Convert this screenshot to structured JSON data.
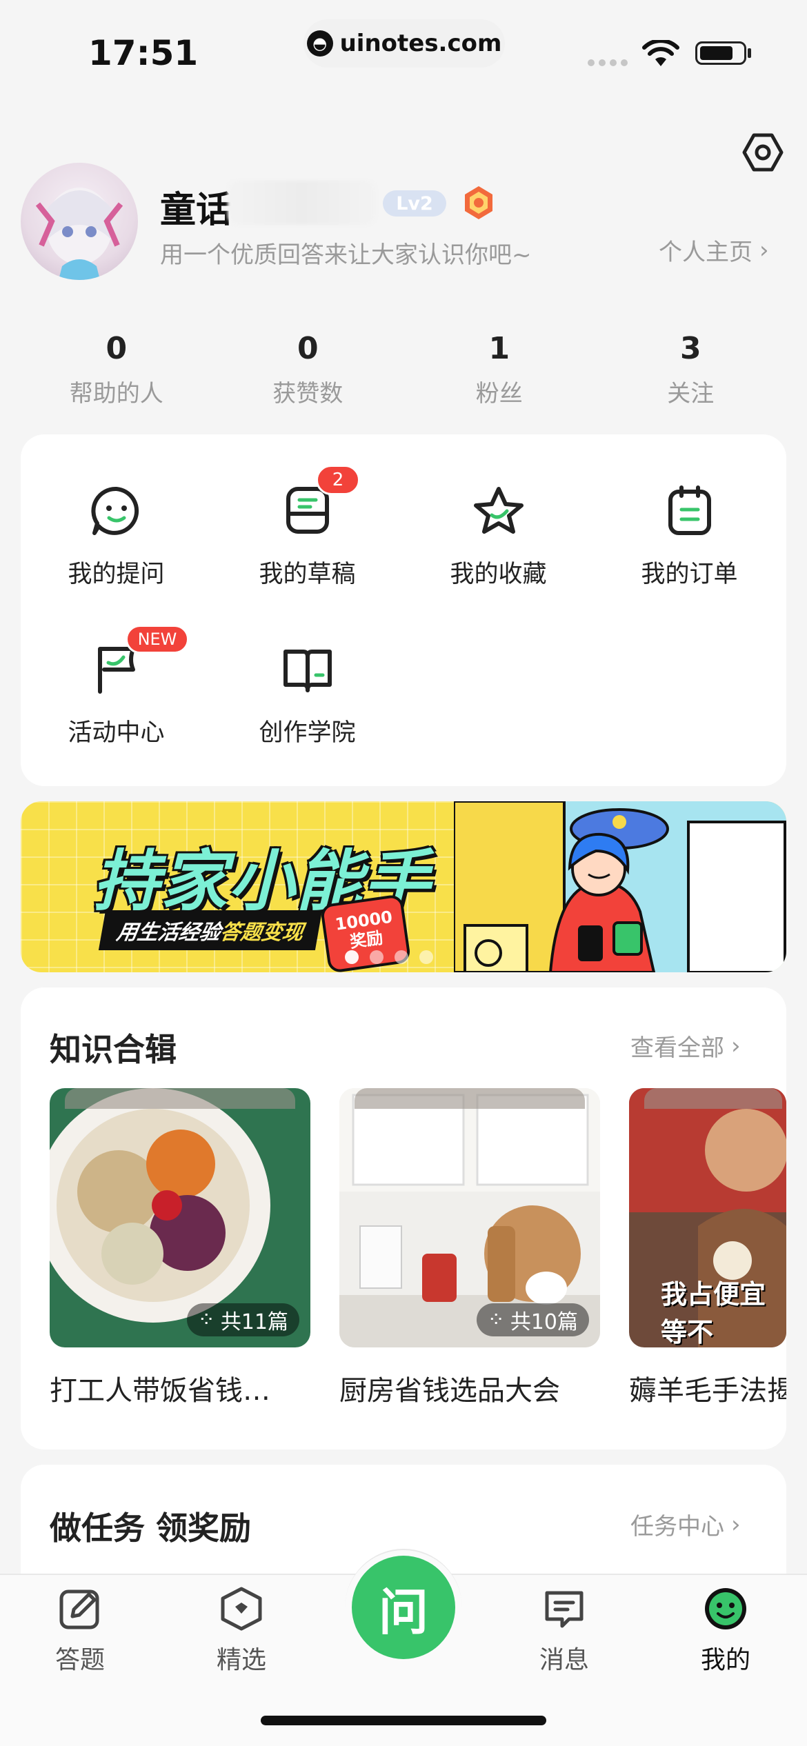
{
  "status_bar": {
    "time": "17:51",
    "url": "uinotes.com"
  },
  "profile": {
    "name": "童话",
    "level": "Lv2",
    "bio": "用一个优质回答来让大家认识你吧~",
    "homepage_link": "个人主页"
  },
  "stats": [
    {
      "value": "0",
      "label": "帮助的人"
    },
    {
      "value": "0",
      "label": "获赞数"
    },
    {
      "value": "1",
      "label": "粉丝"
    },
    {
      "value": "3",
      "label": "关注"
    }
  ],
  "shortcuts": {
    "my_questions": "我的提问",
    "my_drafts": "我的草稿",
    "drafts_badge": "2",
    "my_favorites": "我的收藏",
    "my_orders": "我的订单",
    "activity_center": "活动中心",
    "activity_badge": "NEW",
    "creator_academy": "创作学院"
  },
  "banner": {
    "title": "持家小能手",
    "subtitle_a": "用生活经验",
    "subtitle_b": "答题变现",
    "reward_amount": "10000",
    "reward_label": "奖励"
  },
  "knowledge": {
    "title": "知识合辑",
    "view_all": "查看全部",
    "items": [
      {
        "title": "打工人带饭省钱…",
        "count": "共11篇"
      },
      {
        "title": "厨房省钱选品大会",
        "count": "共10篇"
      },
      {
        "title": "薅羊毛手法揭",
        "caption": "我占便宜 等不"
      }
    ]
  },
  "tasks": {
    "title": "做任务 领奖励",
    "link": "任务中心"
  },
  "tabbar": {
    "answer": "答题",
    "featured": "精选",
    "ask": "问",
    "messages": "消息",
    "mine": "我的"
  },
  "colors": {
    "accent": "#38c46a",
    "badge": "#f2423a",
    "banner_bg": "#f8e04a"
  }
}
